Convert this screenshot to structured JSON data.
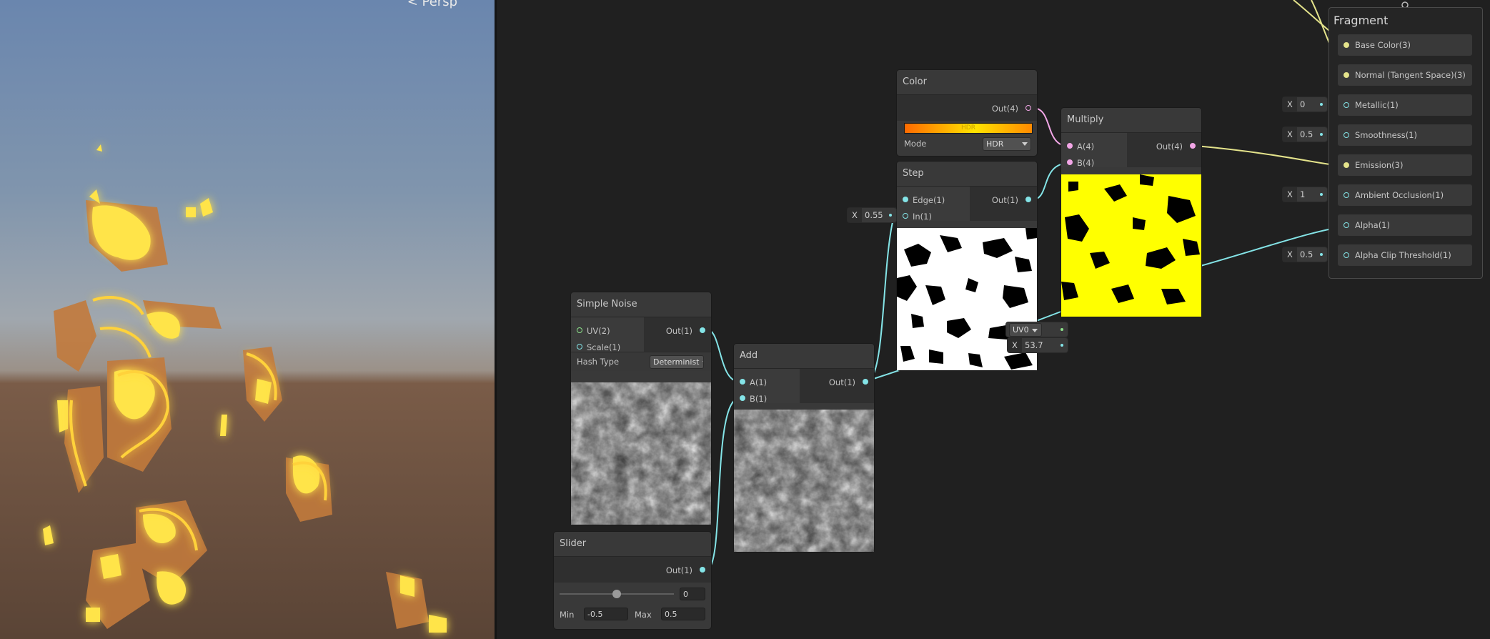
{
  "viewport": {
    "camera_label": "< Persp"
  },
  "nodes": {
    "color": {
      "title": "Color",
      "out_label": "Out(4)",
      "hdr_label": "HDR",
      "mode_label": "Mode",
      "mode_value": "HDR",
      "gradient_colors": [
        "#ff6a00",
        "#ffe400",
        "#ff8a00"
      ]
    },
    "step": {
      "title": "Step",
      "edge_label": "Edge(1)",
      "in_label": "In(1)",
      "out_label": "Out(1)",
      "in_value_prefix": "X",
      "in_value": "0.55"
    },
    "multiply": {
      "title": "Multiply",
      "a_label": "A(4)",
      "b_label": "B(4)",
      "out_label": "Out(4)"
    },
    "simple_noise": {
      "title": "Simple Noise",
      "uv_label": "UV(2)",
      "scale_label": "Scale(1)",
      "out_label": "Out(1)",
      "uv_value": "UV0",
      "scale_prefix": "X",
      "scale_value": "53.7",
      "hash_type_label": "Hash Type",
      "hash_type_value": "Determinist"
    },
    "add": {
      "title": "Add",
      "a_label": "A(1)",
      "b_label": "B(1)",
      "out_label": "Out(1)"
    },
    "slider": {
      "title": "Slider",
      "out_label": "Out(1)",
      "value": "0",
      "slider_fraction": 0.5,
      "min_label": "Min",
      "min_value": "-0.5",
      "max_label": "Max",
      "max_value": "0.5"
    }
  },
  "fragment": {
    "title": "Fragment",
    "rows": [
      {
        "label": "Base Color(3)",
        "port": "yellow"
      },
      {
        "label": "Normal (Tangent Space)(3)",
        "port": "yellow"
      },
      {
        "label": "Metallic(1)",
        "port": "cyan",
        "prefix": "X",
        "value": "0"
      },
      {
        "label": "Smoothness(1)",
        "port": "cyan",
        "prefix": "X",
        "value": "0.5"
      },
      {
        "label": "Emission(3)",
        "port": "yellow"
      },
      {
        "label": "Ambient Occlusion(1)",
        "port": "cyan",
        "prefix": "X",
        "value": "1"
      },
      {
        "label": "Alpha(1)",
        "port": "cyan"
      },
      {
        "label": "Alpha Clip Threshold(1)",
        "port": "cyan",
        "prefix": "X",
        "value": "0.5"
      }
    ]
  },
  "colors": {
    "float_wire": "#84e4e7",
    "vector4_wire": "#f2a6e6",
    "vector3_wire": "#e4e38b",
    "emission_yellow": "#ffff00"
  }
}
